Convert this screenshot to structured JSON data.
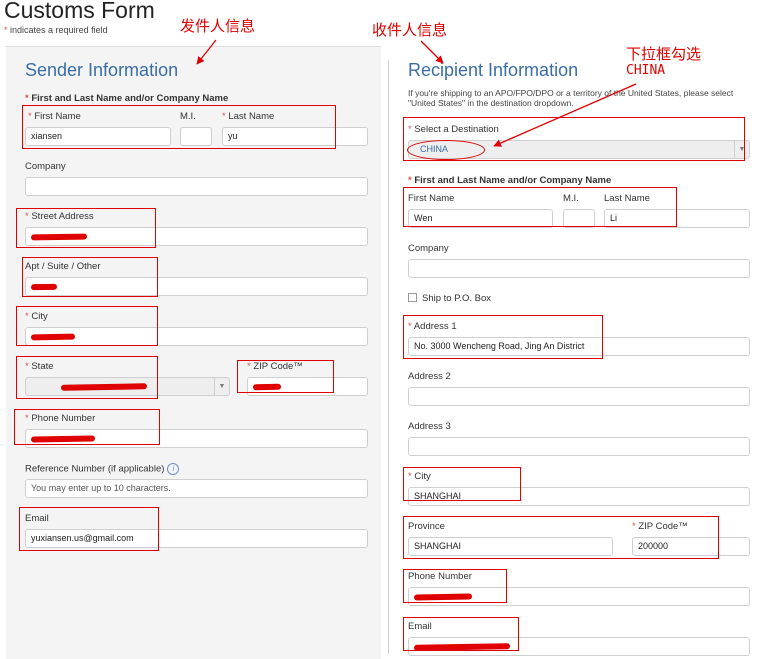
{
  "page": {
    "title": "Customs Form",
    "required_note": "indicates a required field",
    "required_star": "*"
  },
  "annotations": {
    "sender": "发件人信息",
    "recipient": "收件人信息",
    "dropdown_line1": "下拉框勾选",
    "dropdown_line2": "CHINA"
  },
  "sender": {
    "title": "Sender Information",
    "name_group_label": "First and Last Name and/or Company Name",
    "first_name_label": "First Name",
    "first_name_value": "xiansen",
    "mi_label": "M.I.",
    "mi_value": "",
    "last_name_label": "Last Name",
    "last_name_value": "yu",
    "company_label": "Company",
    "company_value": "",
    "street_label": "Street Address",
    "apt_label": "Apt / Suite / Other",
    "city_label": "City",
    "state_label": "State",
    "zip_label": "ZIP Code™",
    "phone_label": "Phone Number",
    "reference_label": "Reference Number (if applicable)",
    "reference_placeholder": "You may enter up to 10 characters.",
    "email_label": "Email",
    "email_value": "yuxiansen.us@gmail.com"
  },
  "recipient": {
    "title": "Recipient Information",
    "note": "If you're shipping to an APO/FPO/DPO or a territory of the United States, please select \"United States\" in the destination dropdown.",
    "destination_label": "Select a Destination",
    "destination_value": "CHINA",
    "name_group_label": "First and Last Name and/or Company Name",
    "first_name_label": "First Name",
    "first_name_value": "Wen",
    "mi_label": "M.I.",
    "mi_value": "",
    "last_name_label": "Last Name",
    "last_name_value": "Li",
    "company_label": "Company",
    "company_value": "",
    "po_box_label": "Ship to P.O. Box",
    "address1_label": "Address 1",
    "address1_value": "No. 3000 Wencheng Road, Jing An District",
    "address2_label": "Address 2",
    "address2_value": "",
    "address3_label": "Address 3",
    "address3_value": "",
    "city_label": "City",
    "city_value": "SHANGHAI",
    "province_label": "Province",
    "province_value": "SHANGHAI",
    "zip_label": "ZIP Code™",
    "zip_value": "200000",
    "phone_label": "Phone Number",
    "email_label": "Email"
  },
  "colors": {
    "annotation": "#e00000",
    "section_title": "#3a6ea5"
  }
}
